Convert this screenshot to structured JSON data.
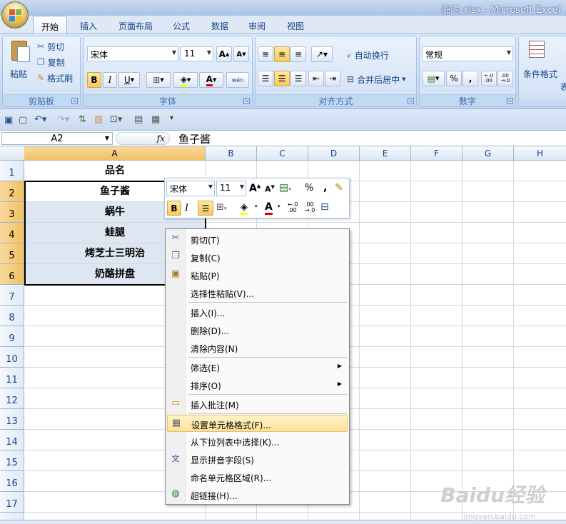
{
  "window": {
    "title": "临时.xlsx - Microsoft Excel"
  },
  "tabs": [
    "开始",
    "插入",
    "页面布局",
    "公式",
    "数据",
    "审阅",
    "视图"
  ],
  "ribbon": {
    "clipboard": {
      "paste": "粘贴",
      "cut": "剪切",
      "copy": "复制",
      "format_painter": "格式刷",
      "label": "剪贴板"
    },
    "font": {
      "name": "宋体",
      "size": "11",
      "bold": "B",
      "italic": "I",
      "underline": "U",
      "label": "字体",
      "phonetic": "wén"
    },
    "alignment": {
      "wrap": "自动换行",
      "merge": "合并后居中",
      "label": "对齐方式"
    },
    "number": {
      "format": "常规",
      "percent": "%",
      "comma": ",",
      "inc_decimal": ".0\n.00",
      "label": "数字"
    },
    "styles": {
      "conditional": "条件格式",
      "partial": "表"
    }
  },
  "formula_bar": {
    "name_box": "A2",
    "fx": "fx",
    "content": "鱼子酱"
  },
  "columns": [
    "A",
    "B",
    "C",
    "D",
    "E",
    "F",
    "G",
    "H"
  ],
  "rows": [
    "1",
    "2",
    "3",
    "4",
    "5",
    "6",
    "7",
    "8",
    "9",
    "10",
    "11",
    "12",
    "13",
    "14",
    "15",
    "16",
    "17"
  ],
  "cells": [
    "品名",
    "鱼子酱",
    "蜗牛",
    "蛙腿",
    "烤芝士三明治",
    "奶酪拼盘"
  ],
  "mini_toolbar": {
    "font": "宋体",
    "size": "11",
    "bold": "B",
    "italic": "I",
    "percent": "%",
    "comma": ","
  },
  "context_menu": [
    {
      "label": "剪切(T)",
      "icon": "scissors-icon"
    },
    {
      "label": "复制(C)",
      "icon": "copy-icon"
    },
    {
      "label": "粘贴(P)",
      "icon": "paste-icon"
    },
    {
      "label": "选择性粘贴(V)...",
      "icon": ""
    },
    {
      "label": "插入(I)...",
      "icon": ""
    },
    {
      "label": "删除(D)...",
      "icon": ""
    },
    {
      "label": "清除内容(N)",
      "icon": ""
    },
    {
      "label": "筛选(E)",
      "icon": "",
      "submenu": true
    },
    {
      "label": "排序(O)",
      "icon": "",
      "submenu": true
    },
    {
      "label": "插入批注(M)",
      "icon": "comment-icon"
    },
    {
      "label": "设置单元格格式(F)...",
      "icon": "format-cells-icon"
    },
    {
      "label": "从下拉列表中选择(K)...",
      "icon": ""
    },
    {
      "label": "显示拼音字段(S)",
      "icon": "phonetic-icon"
    },
    {
      "label": "命名单元格区域(R)...",
      "icon": ""
    },
    {
      "label": "超链接(H)...",
      "icon": "hyperlink-icon"
    }
  ],
  "watermark": {
    "text": "Baidu经验",
    "url": "jingyan.baidu.com"
  }
}
